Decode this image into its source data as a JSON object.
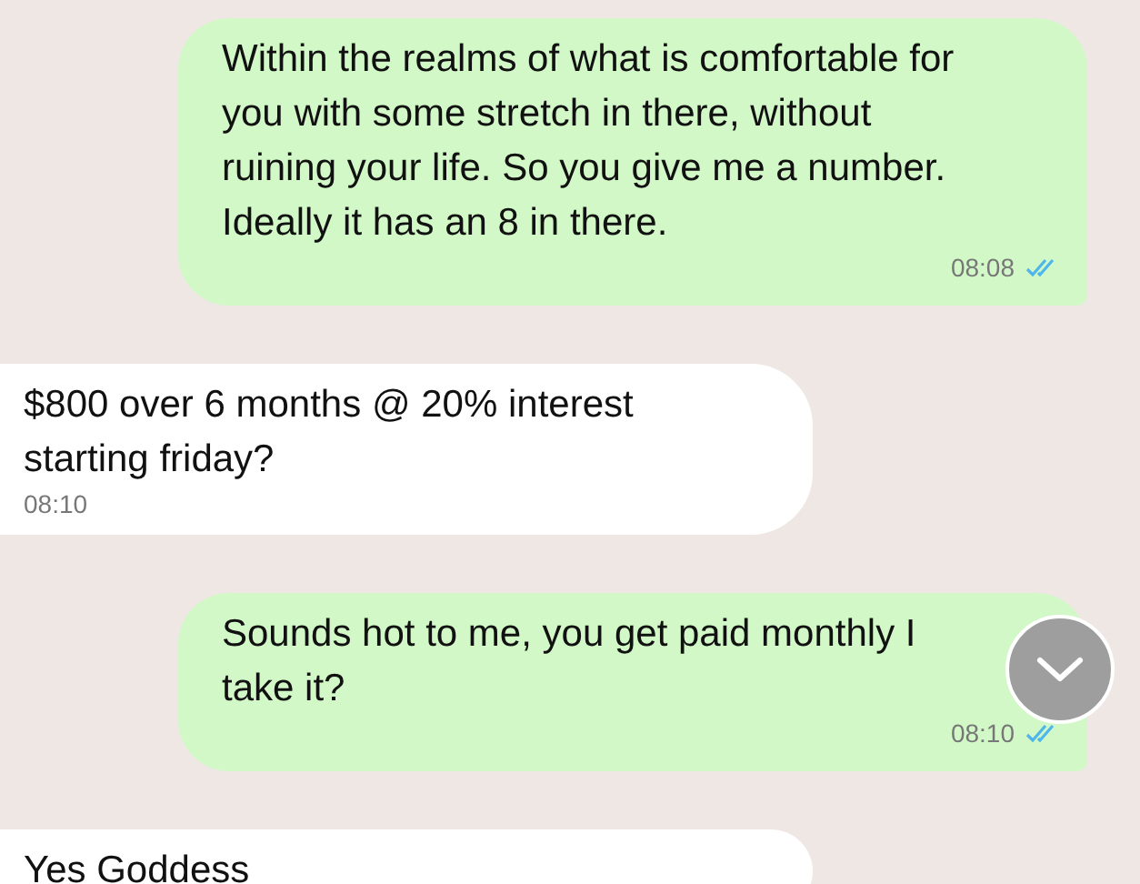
{
  "messages": [
    {
      "kind": "outgoing",
      "text": "Within the realms of what is comfortable for you with some stretch in there, without ruining your life. So you give me a number. Ideally it has an 8 in there.",
      "time": "08:08",
      "read": true
    },
    {
      "kind": "incoming",
      "text": "$800 over 6 months @ 20% interest starting friday?",
      "time": "08:10"
    },
    {
      "kind": "outgoing",
      "text": "Sounds hot to me, you get paid monthly I take it?",
      "time": "08:10",
      "read": true
    },
    {
      "kind": "incoming",
      "text": "Yes Goddess"
    }
  ]
}
